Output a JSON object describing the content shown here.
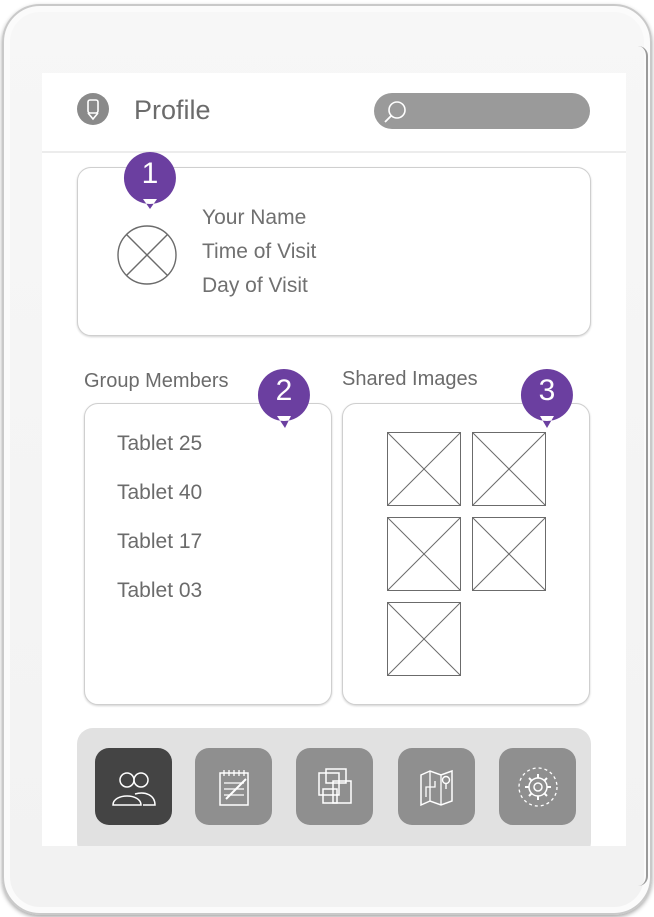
{
  "header": {
    "title": "Profile",
    "search_placeholder": ""
  },
  "profile": {
    "name": "Your Name",
    "time": "Time of Visit",
    "day": "Day of Visit"
  },
  "group": {
    "label": "Group Members",
    "members": [
      "Tablet 25",
      "Tablet 40",
      "Tablet 17",
      "Tablet 03"
    ]
  },
  "shared": {
    "label": "Shared Images",
    "image_count": 5
  },
  "badges": [
    "1",
    "2",
    "3"
  ],
  "nav": {
    "items": [
      {
        "icon": "group-icon",
        "active": true
      },
      {
        "icon": "notes-icon",
        "active": false
      },
      {
        "icon": "gallery-icon",
        "active": false
      },
      {
        "icon": "map-icon",
        "active": false
      },
      {
        "icon": "settings-icon",
        "active": false
      }
    ]
  },
  "colors": {
    "accent": "#6b3fa0",
    "nav_active": "#444444",
    "nav_inactive": "#8f8f8f"
  }
}
